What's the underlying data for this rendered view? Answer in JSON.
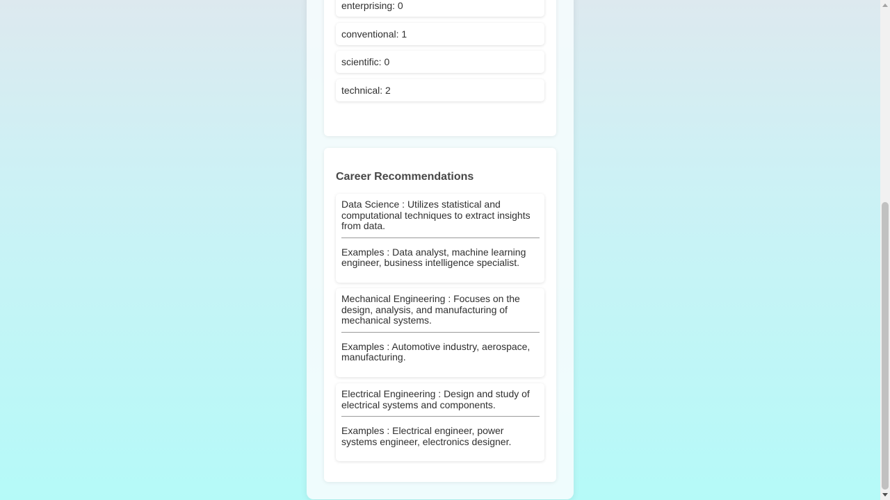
{
  "scores": [
    {
      "label": ""
    },
    {
      "label": "enterprising: 0"
    },
    {
      "label": "conventional: 1"
    },
    {
      "label": "scientific: 0"
    },
    {
      "label": "technical: 2"
    }
  ],
  "careers": {
    "heading": "Career Recommendations",
    "items": [
      {
        "description": "Data Science : Utilizes statistical and computational techniques to extract insights from data.",
        "examples": "Examples : Data analyst, machine learning engineer, business intelligence specialist."
      },
      {
        "description": "Mechanical Engineering : Focuses on the design, analysis, and manufacturing of mechanical systems.",
        "examples": "Examples : Automotive industry, aerospace, manufacturing."
      },
      {
        "description": "Electrical Engineering : Design and study of electrical systems and components.",
        "examples": "Examples : Electrical engineer, power systems engineer, electronics designer."
      }
    ]
  },
  "scrollbar": {
    "icons": [
      "scroll-up-arrow-icon",
      "scroll-down-arrow-icon"
    ]
  }
}
